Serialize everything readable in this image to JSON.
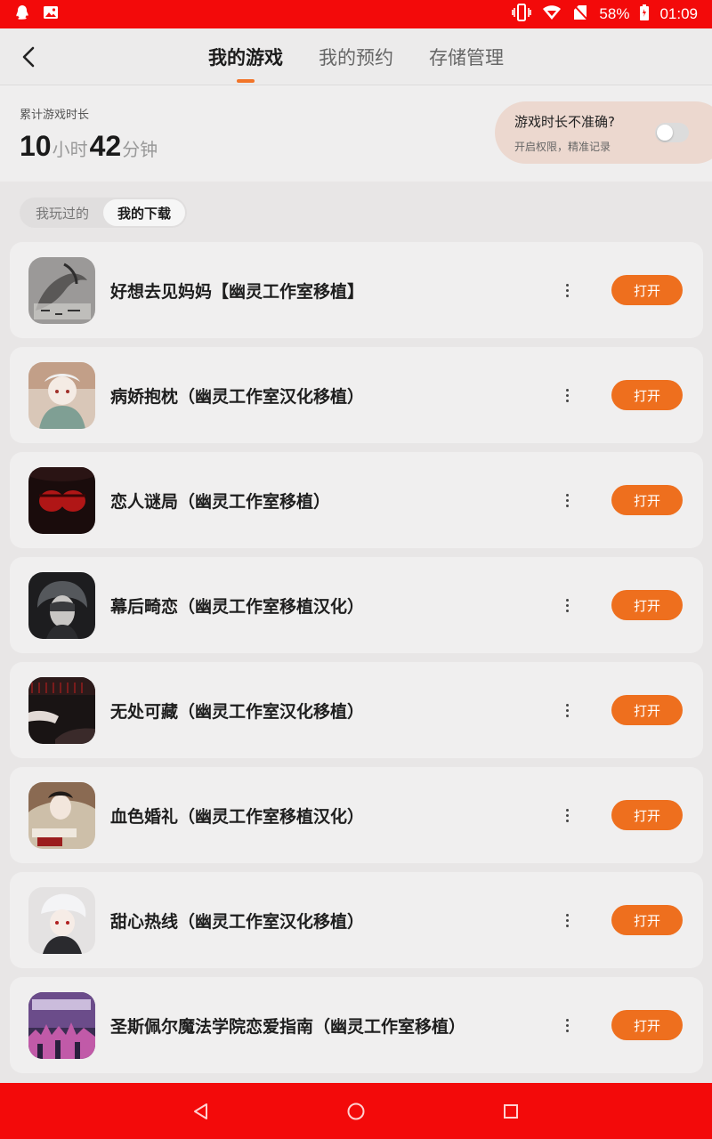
{
  "status_bar": {
    "battery_text": "58%",
    "time": "01:09",
    "icons": [
      "qq-icon",
      "image-icon",
      "vibrate-icon",
      "wifi-icon",
      "no-sim-icon",
      "battery-icon"
    ],
    "background": "#f30a0a"
  },
  "header": {
    "tabs": [
      {
        "label": "我的游戏",
        "active": true
      },
      {
        "label": "我的预约",
        "active": false
      },
      {
        "label": "存储管理",
        "active": false
      }
    ],
    "accent": "#f27428"
  },
  "playtime": {
    "label": "累计游戏时长",
    "hours": "10",
    "hours_unit": "小时",
    "minutes": "42",
    "minutes_unit": "分钟"
  },
  "accuracy_card": {
    "title": "游戏时长不准确?",
    "subtitle": "开启权限，精准记录",
    "toggle_on": false
  },
  "filters": [
    {
      "label": "我玩过的",
      "active": false
    },
    {
      "label": "我的下载",
      "active": true
    }
  ],
  "games": [
    {
      "title": "好想去见妈妈【幽灵工作室移植】",
      "action": "打开"
    },
    {
      "title": "病娇抱枕（幽灵工作室汉化移植）",
      "action": "打开"
    },
    {
      "title": "恋人谜局（幽灵工作室移植）",
      "action": "打开"
    },
    {
      "title": "幕后畸恋（幽灵工作室移植汉化）",
      "action": "打开"
    },
    {
      "title": "无处可藏（幽灵工作室汉化移植）",
      "action": "打开"
    },
    {
      "title": "血色婚礼（幽灵工作室移植汉化）",
      "action": "打开"
    },
    {
      "title": "甜心热线（幽灵工作室汉化移植）",
      "action": "打开"
    },
    {
      "title": "圣斯佩尔魔法学院恋爱指南（幽灵工作室移植）",
      "action": "打开"
    }
  ],
  "button_color": "#ee6f1e",
  "nav_bar": {
    "icons": [
      "back-triangle-icon",
      "home-circle-icon",
      "recents-square-icon"
    ],
    "background": "#f30a0a"
  }
}
